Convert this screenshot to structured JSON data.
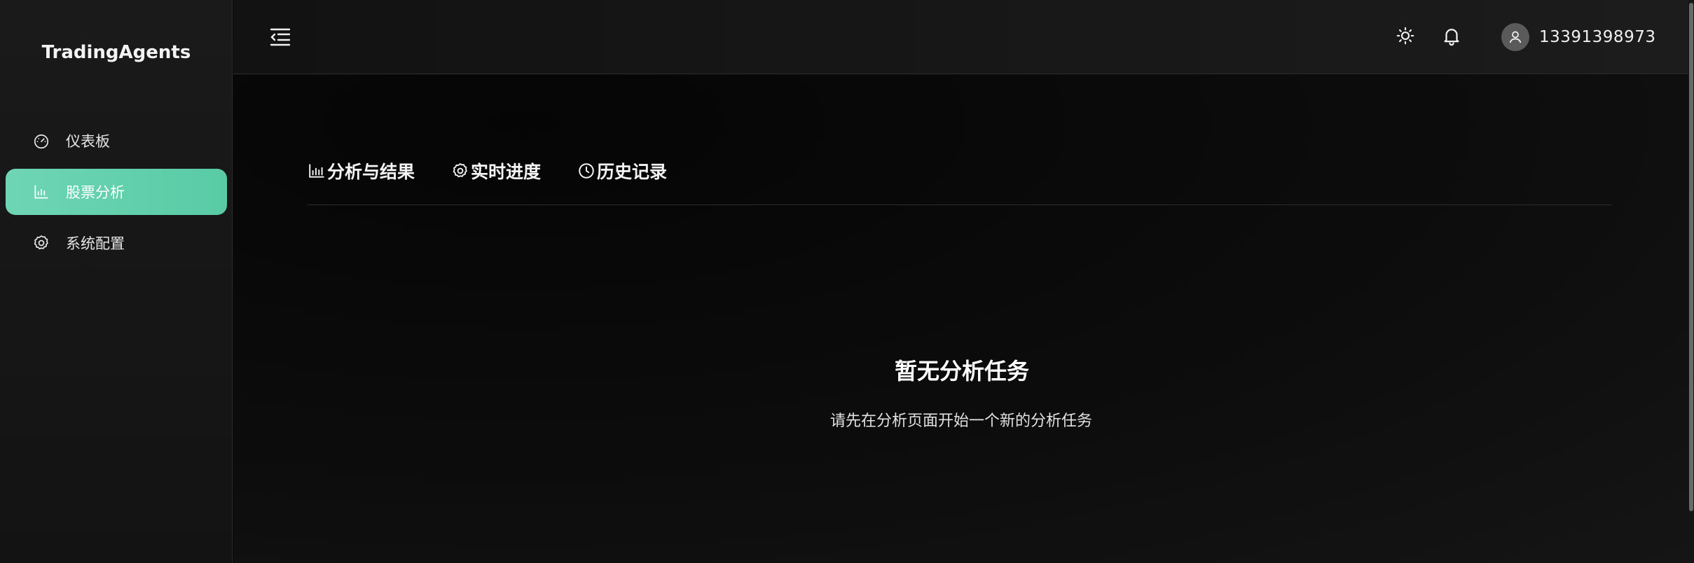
{
  "app": {
    "brand": "TradingAgents"
  },
  "sidebar": {
    "items": [
      {
        "label": "仪表板",
        "icon": "gauge-icon",
        "active": false
      },
      {
        "label": "股票分析",
        "icon": "bar-chart-icon",
        "active": true
      },
      {
        "label": "系统配置",
        "icon": "gear-icon",
        "active": false
      }
    ]
  },
  "header": {
    "toggle_icon": "collapse-menu-icon",
    "theme_icon": "sun-icon",
    "notify_icon": "bell-icon",
    "user": {
      "name": "13391398973",
      "avatar_icon": "user-icon"
    }
  },
  "main": {
    "tabs": [
      {
        "label": "分析与结果",
        "icon": "bar-chart-icon"
      },
      {
        "label": "实时进度",
        "icon": "gear-icon"
      },
      {
        "label": "历史记录",
        "icon": "clock-icon"
      }
    ],
    "empty": {
      "title": "暂无分析任务",
      "subtitle": "请先在分析页面开始一个新的分析任务"
    }
  },
  "colors": {
    "accent": "#5fcfa9",
    "background": "#0b0b0b",
    "sidebar": "#171717"
  }
}
